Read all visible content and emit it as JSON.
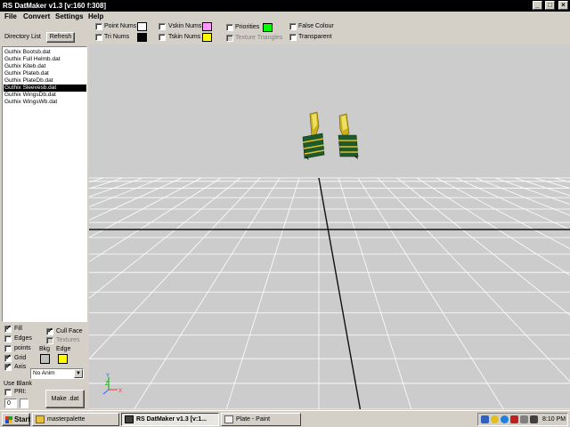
{
  "window": {
    "title": "RS DatMaker v1.3  [v:160 f:308]"
  },
  "menu": [
    "File",
    "Convert",
    "Settings",
    "Help"
  ],
  "toolbar": {
    "directory_list_label": "Directory List",
    "refresh_label": "Refresh",
    "point_nums": {
      "label": "Point Nums",
      "checked": false,
      "swatch": "#ffffff"
    },
    "tri_nums": {
      "label": "Tri Nums",
      "checked": false,
      "swatch": "#000000"
    },
    "vskin_nums": {
      "label": "Vskin Nums",
      "checked": false,
      "swatch": "#ff99ff"
    },
    "tskin_nums": {
      "label": "Tskin Nums",
      "checked": false,
      "swatch": "#ffff00"
    },
    "priorities": {
      "label": "Priorities",
      "checked": false,
      "swatch": "#00ff00"
    },
    "texture_triangles": {
      "label": "Texture Triangles",
      "checked": false,
      "disabled": true
    },
    "false_colour": {
      "label": "False Colour",
      "checked": false
    },
    "transparent": {
      "label": "Transparent",
      "checked": false
    }
  },
  "files": [
    "Guthix Bootsb.dat",
    "Guthix Full Helmb.dat",
    "Guthix Kiteb.dat",
    "Guthix Plateb.dat",
    "Guthix PlateDb.dat",
    "Guthix Sleevesb.dat",
    "Guthix WingsDb.dat",
    "Guthix WingsWb.dat"
  ],
  "selected_file_index": 5,
  "options": {
    "fill": {
      "label": "Fill",
      "checked": true
    },
    "edges": {
      "label": "Edges",
      "checked": false
    },
    "points": {
      "label": "points",
      "checked": false
    },
    "grid": {
      "label": "Grid",
      "checked": true
    },
    "axis": {
      "label": "Axis",
      "checked": true
    },
    "cull_face": {
      "label": "Cull Face",
      "checked": true
    },
    "textures": {
      "label": "Textures",
      "checked": false,
      "disabled": true
    },
    "bkg_label": "Bkg",
    "edge_label": "Edge",
    "bkg_color": "#c0c0c0",
    "edge_color": "#ffff00",
    "anim_select": "No Anim",
    "use_blank_label": "Use Blank",
    "pri_label": "PRI:",
    "pri_value": "0",
    "make_dat_label": "Make .dat"
  },
  "viewport": {
    "background": "#cccccc",
    "axis_labels": {
      "x": "X",
      "y": "Y",
      "z": "Z"
    }
  },
  "taskbar": {
    "start_label": "Start",
    "tasks": [
      {
        "label": "masterpalette",
        "active": false,
        "icon": "folder-icon"
      },
      {
        "label": "RS DatMaker v1.3  [v:1...",
        "active": true,
        "icon": "app-icon"
      },
      {
        "label": "Plate - Paint",
        "active": false,
        "icon": "paint-icon"
      }
    ],
    "clock": "8:10 PM"
  }
}
